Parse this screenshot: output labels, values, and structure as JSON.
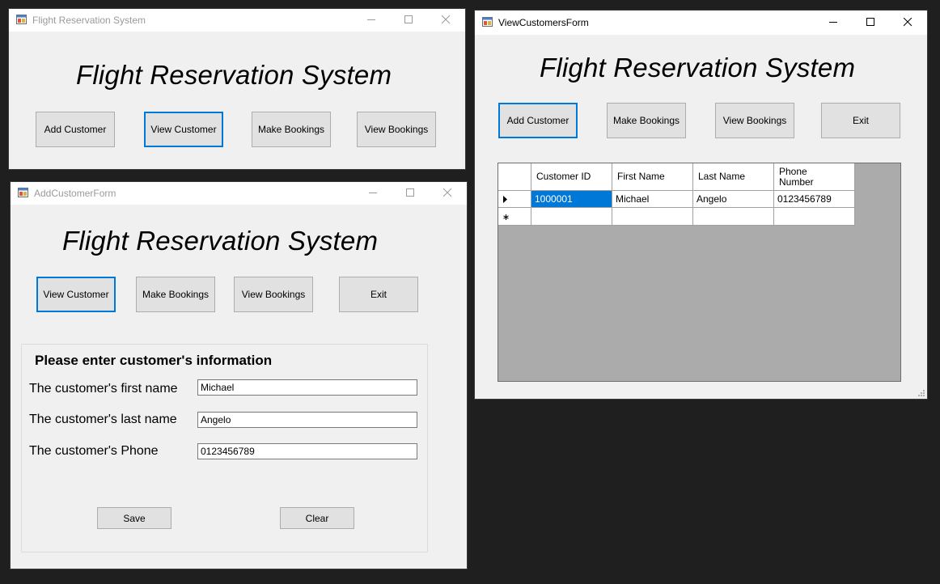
{
  "main_window": {
    "title": "Flight Reservation System",
    "heading": "Flight Reservation System",
    "buttons": {
      "add_customer": "Add Customer",
      "view_customer": "View Customer",
      "make_bookings": "Make Bookings",
      "view_bookings": "View Bookings"
    }
  },
  "add_customer_form": {
    "title": "AddCustomerForm",
    "heading": "Flight Reservation System",
    "buttons": {
      "view_customer": "View Customer",
      "make_bookings": "Make Bookings",
      "view_bookings": "View Bookings",
      "exit": "Exit"
    },
    "group_title": "Please enter customer's information",
    "fields": {
      "first_name": {
        "label": "The customer's first name",
        "value": "Michael"
      },
      "last_name": {
        "label": "The customer's last name",
        "value": "Angelo"
      },
      "phone": {
        "label": "The customer's Phone",
        "value": "0123456789"
      }
    },
    "save_label": "Save",
    "clear_label": "Clear"
  },
  "view_customers_form": {
    "title": "ViewCustomersForm",
    "heading": "Flight Reservation System",
    "buttons": {
      "add_customer": "Add Customer",
      "make_bookings": "Make Bookings",
      "view_bookings": "View Bookings",
      "exit": "Exit"
    },
    "grid": {
      "columns": [
        "Customer ID",
        "First Name",
        "Last Name",
        "Phone Number"
      ],
      "rows": [
        [
          "1000001",
          "Michael",
          "Angelo",
          "0123456789"
        ]
      ],
      "selected_cell": "1000001"
    }
  },
  "icons": {
    "app": "windows-form-app-icon",
    "minimize": "minimize-icon",
    "maximize": "maximize-icon",
    "close": "close-icon",
    "row_pointer": "row-pointer-icon",
    "new_row": "new-row-asterisk-icon",
    "resize_grip": "resize-grip-icon"
  },
  "colors": {
    "window_bg": "#f0f0f0",
    "desktop_bg": "#1f1f1f",
    "focus_border": "#0078d7",
    "selected_cell": "#0078d7",
    "grid_bg": "#ababab"
  }
}
